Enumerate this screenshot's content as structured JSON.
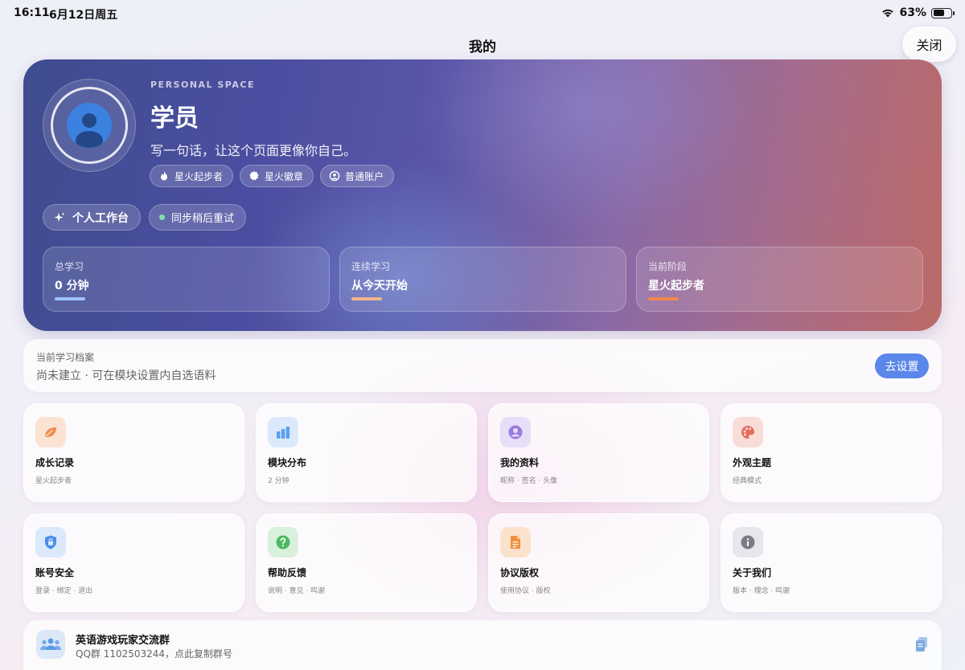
{
  "status_bar": {
    "time": "16:11",
    "date": "6月12日周五",
    "battery_percent": "63%",
    "battery_level": 0.63
  },
  "header": {
    "title": "我的",
    "close_label": "关闭"
  },
  "hero": {
    "kicker": "PERSONAL SPACE",
    "name": "学员",
    "bio": "写一句话，让这个页面更像你自己。",
    "chips": [
      {
        "label": "星火起步者",
        "icon": "flame-icon"
      },
      {
        "label": "星火徽章",
        "icon": "badge-icon"
      },
      {
        "label": "普通账户",
        "icon": "account-icon"
      }
    ],
    "workbench_label": "个人工作台",
    "sync_label": "同步稍后重试",
    "stats": [
      {
        "label": "总学习",
        "value": "0 分钟",
        "color": "#9ec3ff"
      },
      {
        "label": "连续学习",
        "value": "从今天开始",
        "color": "#f1b58b"
      },
      {
        "label": "当前阶段",
        "value": "星火起步者",
        "color": "#ef8a4e"
      }
    ]
  },
  "profile": {
    "label": "当前学习档案",
    "value": "尚未建立 · 可在模块设置内自选语料",
    "button": "去设置"
  },
  "tiles": [
    {
      "title": "成长记录",
      "sub": "星火起步者",
      "icon": "leaf-icon",
      "bg": "#fbe3d3",
      "fg": "#ef8a4e"
    },
    {
      "title": "模块分布",
      "sub": "2 分钟",
      "icon": "bar-chart-icon",
      "bg": "#dbe9fb",
      "fg": "#5aa0ee"
    },
    {
      "title": "我的资料",
      "sub": "昵称 · 签名 · 头像",
      "icon": "person-icon",
      "bg": "#e7def7",
      "fg": "#9a7be0"
    },
    {
      "title": "外观主题",
      "sub": "经典模式",
      "icon": "palette-icon",
      "bg": "#f8dcd8",
      "fg": "#e36c5c"
    },
    {
      "title": "账号安全",
      "sub": "登录 · 绑定 · 退出",
      "icon": "lock-icon",
      "bg": "#dbe9fb",
      "fg": "#4a8ee8"
    },
    {
      "title": "帮助反馈",
      "sub": "说明 · 意见 · 鸣谢",
      "icon": "question-icon",
      "bg": "#d9f0dc",
      "fg": "#4cb860"
    },
    {
      "title": "协议版权",
      "sub": "使用协议 · 版权",
      "icon": "document-icon",
      "bg": "#fbe2cc",
      "fg": "#f0903e"
    },
    {
      "title": "关于我们",
      "sub": "版本 · 理念 · 鸣谢",
      "icon": "info-icon",
      "bg": "#e6e6ec",
      "fg": "#7c7c86"
    }
  ],
  "group": {
    "title": "英语游戏玩家交流群",
    "sub": "QQ群 1102503244，点此复制群号",
    "icon": "group-icon"
  }
}
